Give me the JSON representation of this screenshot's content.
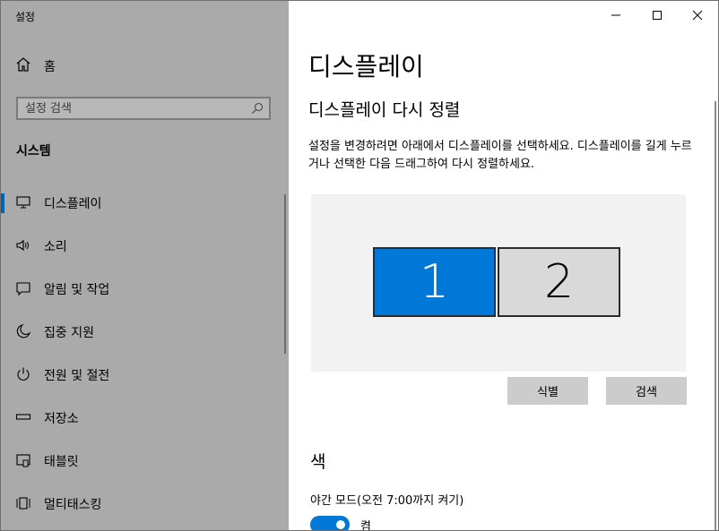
{
  "app": {
    "title": "설정"
  },
  "sidebar": {
    "home_label": "홈",
    "search": {
      "placeholder": "설정 검색"
    },
    "section_title": "시스템",
    "items": [
      {
        "label": "디스플레이",
        "icon": "monitor-icon",
        "active": true
      },
      {
        "label": "소리",
        "icon": "speaker-icon"
      },
      {
        "label": "알림 및 작업",
        "icon": "message-icon"
      },
      {
        "label": "집중 지원",
        "icon": "moon-icon"
      },
      {
        "label": "전원 및 절전",
        "icon": "power-icon"
      },
      {
        "label": "저장소",
        "icon": "storage-icon"
      },
      {
        "label": "태블릿",
        "icon": "tablet-icon"
      },
      {
        "label": "멀티태스킹",
        "icon": "multitask-icon"
      }
    ]
  },
  "main": {
    "title": "디스플레이",
    "subtitle": "디스플레이 다시 정렬",
    "description": "설정을 변경하려면 아래에서 디스플레이를 선택하세요. 디스플레이를 길게 누르거나 선택한 다음 드래그하여 다시 정렬하세요.",
    "monitors": [
      {
        "label": "1",
        "selected": true
      },
      {
        "label": "2",
        "selected": false
      }
    ],
    "identify_button": "식별",
    "detect_button": "검색",
    "color_section": "색",
    "night_light_label": "야간 모드(오전 7:00까지 켜기)",
    "night_light_state": "켬"
  },
  "colors": {
    "accent": "#0078d7",
    "sidebar_bg": "#aaaaaa",
    "display_area_bg": "#f2f2f2",
    "button_bg": "#cccccc"
  }
}
